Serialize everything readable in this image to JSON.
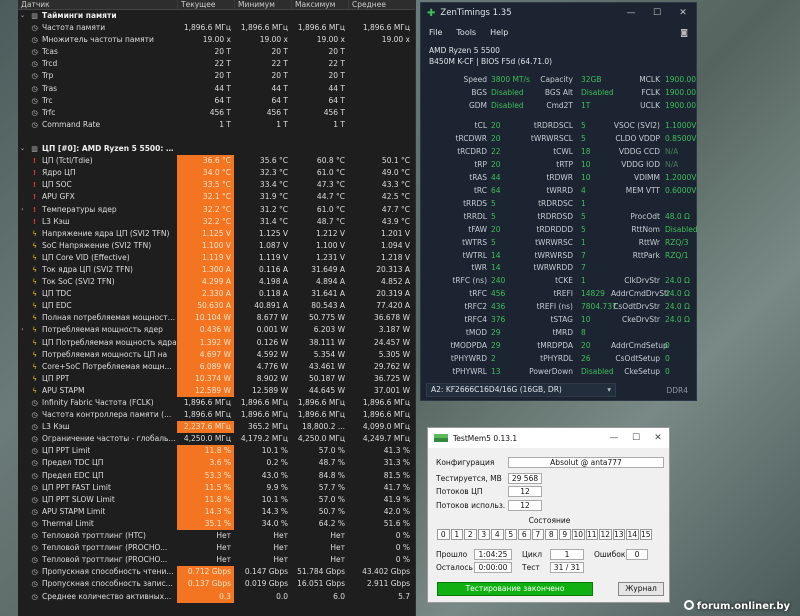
{
  "hwinfo": {
    "columns": [
      "Датчик",
      "Текущее",
      "Минимум",
      "Максимум",
      "Среднее"
    ],
    "rows": [
      {
        "t": "section",
        "name": "Тайминги памяти",
        "ico": "sect"
      },
      {
        "name": "Частота памяти",
        "ico": "clock",
        "v": [
          "1,896.6 МГц",
          "1,896.6 МГц",
          "1,896.6 МГц",
          "1,896.6 МГц"
        ]
      },
      {
        "name": "Множитель частоты памяти",
        "ico": "clock",
        "v": [
          "19.00 x",
          "19.00 x",
          "19.00 x",
          "19.00 x"
        ]
      },
      {
        "name": "Tcas",
        "ico": "clock",
        "v": [
          "20 T",
          "20 T",
          "20 T",
          ""
        ]
      },
      {
        "name": "Trcd",
        "ico": "clock",
        "v": [
          "22 T",
          "22 T",
          "22 T",
          ""
        ]
      },
      {
        "name": "Trp",
        "ico": "clock",
        "v": [
          "20 T",
          "20 T",
          "20 T",
          ""
        ]
      },
      {
        "name": "Tras",
        "ico": "clock",
        "v": [
          "44 T",
          "44 T",
          "44 T",
          ""
        ]
      },
      {
        "name": "Trc",
        "ico": "clock",
        "v": [
          "64 T",
          "64 T",
          "64 T",
          ""
        ]
      },
      {
        "name": "Trfc",
        "ico": "clock",
        "v": [
          "456 T",
          "456 T",
          "456 T",
          ""
        ]
      },
      {
        "name": "Command Rate",
        "ico": "clock",
        "v": [
          "1 T",
          "1 T",
          "1 T",
          ""
        ]
      },
      {
        "t": "gap"
      },
      {
        "t": "section",
        "name": "ЦП [#0]: AMD Ryzen 5 5500: Enhanced",
        "ico": "sect"
      },
      {
        "name": "ЦП (Tctl/Tdie)",
        "ico": "therm",
        "hl": true,
        "v": [
          "36.6 °C",
          "35.6 °C",
          "60.8 °C",
          "50.1 °C"
        ]
      },
      {
        "name": "Ядро ЦП",
        "ico": "therm",
        "hl": true,
        "v": [
          "34.0 °C",
          "32.3 °C",
          "61.0 °C",
          "49.0 °C"
        ]
      },
      {
        "name": "ЦП SOC",
        "ico": "therm",
        "hl": true,
        "v": [
          "33.5 °C",
          "33.4 °C",
          "47.3 °C",
          "43.3 °C"
        ]
      },
      {
        "name": "APU GFX",
        "ico": "therm",
        "hl": true,
        "v": [
          "32.1 °C",
          "31.9 °C",
          "44.7 °C",
          "42.5 °C"
        ]
      },
      {
        "name": "Температуры ядер",
        "ico": "therm",
        "exp": true,
        "hl": true,
        "v": [
          "32.2 °C",
          "31.2 °C",
          "61.0 °C",
          "47.7 °C"
        ]
      },
      {
        "name": "L3 Кэш",
        "ico": "therm",
        "hl": true,
        "v": [
          "32.2 °C",
          "31.4 °C",
          "48.7 °C",
          "43.9 °C"
        ]
      },
      {
        "name": "Напряжение ядра ЦП (SVI2 TFN)",
        "ico": "bolt",
        "hl": true,
        "v": [
          "1.125 V",
          "1.125 V",
          "1.212 V",
          "1.201 V"
        ]
      },
      {
        "name": "SoC Напряжение (SVI2 TFN)",
        "ico": "bolt",
        "hl": true,
        "v": [
          "1.100 V",
          "1.087 V",
          "1.100 V",
          "1.094 V"
        ]
      },
      {
        "name": "ЦП Core VID (Effective)",
        "ico": "bolt",
        "hl": true,
        "v": [
          "1.119 V",
          "1.119 V",
          "1.231 V",
          "1.218 V"
        ]
      },
      {
        "name": "Ток ядра ЦП (SVI2 TFN)",
        "ico": "bolt",
        "hl": true,
        "v": [
          "1.300 A",
          "0.116 A",
          "31.649 A",
          "20.313 A"
        ]
      },
      {
        "name": "Ток SoC (SVI2 TFN)",
        "ico": "bolt",
        "hl": true,
        "v": [
          "4.299 A",
          "4.198 A",
          "4.894 A",
          "4.852 A"
        ]
      },
      {
        "name": "ЦП TDC",
        "ico": "bolt",
        "hl": true,
        "v": [
          "2.330 A",
          "0.118 A",
          "31.641 A",
          "20.319 A"
        ]
      },
      {
        "name": "ЦП EDC",
        "ico": "bolt",
        "hl": true,
        "v": [
          "50.630 A",
          "40.891 A",
          "80.543 A",
          "77.420 A"
        ]
      },
      {
        "name": "Полная потребляемая мощность ЦП",
        "ico": "bolt",
        "hl": true,
        "v": [
          "10.104 W",
          "8.677 W",
          "50.775 W",
          "36.678 W"
        ]
      },
      {
        "name": "Потребляемая мощность ядер",
        "ico": "bolt",
        "exp": true,
        "hl": true,
        "v": [
          "0.436 W",
          "0.001 W",
          "6.203 W",
          "3.187 W"
        ]
      },
      {
        "name": "ЦП Потребляемая мощность ядра",
        "ico": "bolt",
        "hl": true,
        "v": [
          "1.392 W",
          "0.126 W",
          "38.111 W",
          "24.457 W"
        ]
      },
      {
        "name": "Потребляемая мощность ЦП на",
        "ico": "bolt",
        "hl": true,
        "v": [
          "4.697 W",
          "4.592 W",
          "5.354 W",
          "5.305 W"
        ]
      },
      {
        "name": "Core+SoC Потребляемая мощн...",
        "ico": "bolt",
        "hl": true,
        "v": [
          "6.089 W",
          "4.776 W",
          "43.461 W",
          "29.762 W"
        ]
      },
      {
        "name": "ЦП PPT",
        "ico": "bolt",
        "hl": true,
        "v": [
          "10.374 W",
          "8.902 W",
          "50.187 W",
          "36.725 W"
        ]
      },
      {
        "name": "APU STAPM",
        "ico": "bolt",
        "hl": true,
        "v": [
          "12.589 W",
          "12.589 W",
          "44.645 W",
          "37.001 W"
        ]
      },
      {
        "name": "Infinity Fabric Частота (FCLK)",
        "ico": "clock",
        "v": [
          "1,896.6 МГц",
          "1,896.6 МГц",
          "1,896.6 МГц",
          "1,896.6 МГц"
        ]
      },
      {
        "name": "Частота контроллера памяти (...",
        "ico": "clock",
        "v": [
          "1,896.6 МГц",
          "1,896.6 МГц",
          "1,896.6 МГц",
          "1,896.6 МГц"
        ]
      },
      {
        "name": "L3 Кэш",
        "ico": "clock",
        "hl": true,
        "v": [
          "2,237.6 МГц",
          "365.2 МГц",
          "18,800.2 ...",
          "4,099.0 МГц"
        ]
      },
      {
        "name": "Ограничение частоты - глобаль...",
        "ico": "clock",
        "v": [
          "4,250.0 МГц",
          "4,179.2 МГц",
          "4,250.0 МГц",
          "4,249.7 МГц"
        ]
      },
      {
        "name": "ЦП PPT Limit",
        "ico": "clock",
        "hl": true,
        "v": [
          "11.8 %",
          "10.1 %",
          "57.0 %",
          "41.3 %"
        ]
      },
      {
        "name": "Предел TDC ЦП",
        "ico": "clock",
        "hl": true,
        "v": [
          "3.6 %",
          "0.2 %",
          "48.7 %",
          "31.3 %"
        ]
      },
      {
        "name": "Предел EDC ЦП",
        "ico": "clock",
        "hl": true,
        "v": [
          "53.3 %",
          "43.0 %",
          "84.8 %",
          "81.5 %"
        ]
      },
      {
        "name": "ЦП PPT FAST Limit",
        "ico": "clock",
        "hl": true,
        "v": [
          "11.5 %",
          "9.9 %",
          "57.7 %",
          "41.7 %"
        ]
      },
      {
        "name": "ЦП PPT SLOW Limit",
        "ico": "clock",
        "hl": true,
        "v": [
          "11.8 %",
          "10.1 %",
          "57.0 %",
          "41.9 %"
        ]
      },
      {
        "name": "APU STAPM Limit",
        "ico": "clock",
        "hl": true,
        "v": [
          "14.3 %",
          "14.3 %",
          "50.7 %",
          "42.0 %"
        ]
      },
      {
        "name": "Thermal Limit",
        "ico": "clock",
        "hl": true,
        "v": [
          "35.1 %",
          "34.0 %",
          "64.2 %",
          "51.6 %"
        ]
      },
      {
        "name": "Тепловой троттлинг (HTC)",
        "ico": "clock",
        "v": [
          "Нет",
          "Нет",
          "Нет",
          "0 %"
        ]
      },
      {
        "name": "Тепловой троттлинг (PROCHO...",
        "ico": "clock",
        "v": [
          "Нет",
          "Нет",
          "Нет",
          "0 %"
        ]
      },
      {
        "name": "Тепловой троттлинг (PROCHO...",
        "ico": "clock",
        "v": [
          "Нет",
          "Нет",
          "Нет",
          "0 %"
        ]
      },
      {
        "name": "Пропускная способность чтени...",
        "ico": "clock",
        "hl": true,
        "v": [
          "0.712 Gbps",
          "0.147 Gbps",
          "51.784 Gbps",
          "43.402 Gbps"
        ]
      },
      {
        "name": "Пропускная способность запис...",
        "ico": "clock",
        "hl": true,
        "v": [
          "0.137 Gbps",
          "0.019 Gbps",
          "16.051 Gbps",
          "2.911 Gbps"
        ]
      },
      {
        "name": "Среднее количество активных...",
        "ico": "clock",
        "hl": true,
        "v": [
          "0.3",
          "0.0",
          "6.0",
          "5.7"
        ]
      }
    ]
  },
  "zentimings": {
    "title": "ZenTimings 1.35",
    "menu": [
      "File",
      "Tools",
      "Help"
    ],
    "cpu": "AMD Ryzen 5 5500",
    "board": "B450M K-CF | BIOS F5d (64.71.0)",
    "top": [
      [
        "Speed",
        "3800 MT/s",
        "Capacity",
        "32GB",
        "MCLK",
        "1900.00"
      ],
      [
        "BGS",
        "Disabled",
        "BGS Alt",
        "Disabled",
        "FCLK",
        "1900.00"
      ],
      [
        "GDM",
        "Disabled",
        "Cmd2T",
        "1T",
        "UCLK",
        "1900.00"
      ]
    ],
    "timings": [
      [
        "tCL",
        "20",
        "tRDRDSCL",
        "5",
        "VSOC (SVI2)",
        "1.1000V"
      ],
      [
        "tRCDWR",
        "20",
        "tWRWRSCL",
        "5",
        "CLDO VDDP",
        "0.8500V"
      ],
      [
        "tRCDRD",
        "22",
        "tCWL",
        "18",
        "VDDG CCD",
        "N/A"
      ],
      [
        "tRP",
        "20",
        "tRTP",
        "10",
        "VDDG IOD",
        "N/A"
      ],
      [
        "tRAS",
        "44",
        "tRDWR",
        "10",
        "VDIMM",
        "1.2000V"
      ],
      [
        "tRC",
        "64",
        "tWRRD",
        "4",
        "MEM VTT",
        "0.6000V"
      ],
      [
        "tRRDS",
        "5",
        "tRDRDSC",
        "1",
        "",
        ""
      ],
      [
        "tRRDL",
        "5",
        "tRDRDSD",
        "5",
        "ProcOdt",
        "48.0 Ω"
      ],
      [
        "tFAW",
        "20",
        "tRDRDDD",
        "5",
        "RttNom",
        "Disabled"
      ],
      [
        "tWTRS",
        "5",
        "tWRWRSC",
        "1",
        "RttWr",
        "RZQ/3"
      ],
      [
        "tWTRL",
        "14",
        "tWRWRSD",
        "7",
        "RttPark",
        "RZQ/1"
      ],
      [
        "tWR",
        "14",
        "tWRWRDD",
        "7",
        "",
        ""
      ],
      [
        "tRFC (ns)",
        "240",
        "tCKE",
        "1",
        "ClkDrvStr",
        "24.0 Ω"
      ],
      [
        "tRFC",
        "456",
        "tREFI",
        "14829",
        "AddrCmdDrvStr",
        "24.0 Ω"
      ],
      [
        "tRFC2",
        "436",
        "tREFI (ns)",
        "7804.737",
        "CsOdtDrvStr",
        "24.0 Ω"
      ],
      [
        "tRFC4",
        "376",
        "tSTAG",
        "10",
        "CkeDrvStr",
        "24.0 Ω"
      ],
      [
        "tMOD",
        "29",
        "tMRD",
        "8",
        "",
        ""
      ],
      [
        "tMODPDA",
        "29",
        "tMRDPDA",
        "20",
        "AddrCmdSetup",
        "0"
      ],
      [
        "tPHYWRD",
        "2",
        "tPHYRDL",
        "26",
        "CsOdtSetup",
        "0"
      ],
      [
        "tPHYWRL",
        "13",
        "PowerDown",
        "Disabled",
        "CkeSetup",
        "0"
      ]
    ],
    "module": "A2: KF2666C16D4/16G (16GB, DR)",
    "ddr": "DDR4",
    "colors": {
      "green": "#3fbf5a",
      "bg": "#1b2430"
    }
  },
  "testmem": {
    "title": "TestMem5  0.13.1",
    "config_label": "Конфигурация",
    "config_value": "Absolut @ anta777",
    "tested_label": "Тестируется, МВ",
    "tested_value": "29 568",
    "threads_label": "Потоков ЦП",
    "threads_value": "12",
    "used_label": "Потоков использ.",
    "used_value": "12",
    "state_label": "Состояние",
    "cells": [
      "0",
      "1",
      "2",
      "3",
      "4",
      "5",
      "6",
      "7",
      "8",
      "9",
      "10",
      "11",
      "12",
      "13",
      "14",
      "15"
    ],
    "elapsed_label": "Прошло",
    "elapsed_value": "1:04:25",
    "cycle_label": "Цикл",
    "cycle_value": "1",
    "errors_label": "Ошибок",
    "errors_value": "0",
    "remain_label": "Осталось",
    "remain_value": "0:00:00",
    "test_label": "Тест",
    "test_value": "31 / 31",
    "status_button": "Тестирование закончено",
    "log_button": "Журнал"
  },
  "watermark": "forum.onliner.by"
}
